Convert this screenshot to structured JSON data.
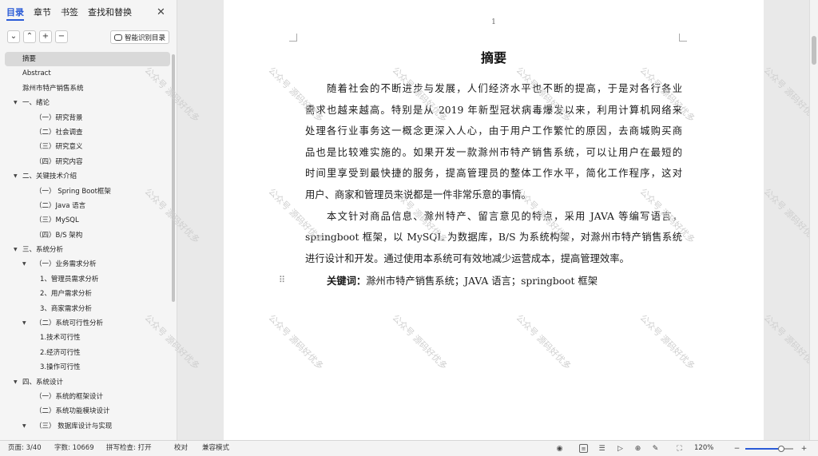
{
  "nav": {
    "tabs": [
      "目录",
      "章节",
      "书签",
      "查找和替换"
    ],
    "smart_toc_label": "智能识别目录",
    "toc": [
      {
        "label": "摘要",
        "level": 0,
        "selected": true
      },
      {
        "label": "Abstract",
        "level": 0
      },
      {
        "label": "滁州市特产销售系统",
        "level": 0
      },
      {
        "label": "一、绪论",
        "level": 0,
        "caret": true
      },
      {
        "label": "（一）研究背景",
        "level": 1
      },
      {
        "label": "（二）社会调查",
        "level": 1
      },
      {
        "label": "（三）研究意义",
        "level": 1
      },
      {
        "label": "（四）研究内容",
        "level": 1
      },
      {
        "label": "二、关键技术介绍",
        "level": 0,
        "caret": true
      },
      {
        "label": "（一）    Spring Boot框架",
        "level": 1
      },
      {
        "label": "（二）Java 语言",
        "level": 1
      },
      {
        "label": "（三）MySQL",
        "level": 1
      },
      {
        "label": "（四）B/S 架构",
        "level": 1
      },
      {
        "label": "三、系统分析",
        "level": 0,
        "caret": true
      },
      {
        "label": "（一）业务需求分析",
        "level": 1,
        "caret": true
      },
      {
        "label": "1、管理员需求分析",
        "level": 2
      },
      {
        "label": "2、用户需求分析",
        "level": 2
      },
      {
        "label": "3、商家需求分析",
        "level": 2
      },
      {
        "label": "（二）系统可行性分析",
        "level": 1,
        "caret": true
      },
      {
        "label": "1.技术可行性",
        "level": 2
      },
      {
        "label": "2.经济可行性",
        "level": 2
      },
      {
        "label": "3.操作可行性",
        "level": 2
      },
      {
        "label": "四、系统设计",
        "level": 0,
        "caret": true
      },
      {
        "label": "（一）系统的框架设计",
        "level": 1
      },
      {
        "label": "（二）系统功能模块设计",
        "level": 1
      },
      {
        "label": "（三）    数据库设计与实现",
        "level": 1,
        "caret": true
      }
    ]
  },
  "document": {
    "page_number": "1",
    "title": "摘要",
    "lines": [
      "　　随着社会的不断进步与发展，人们经济水平也不断的提高，于是对各行各业",
      "需求也越来越高。特别是从 2019 年新型冠状病毒爆发以来，利用计算机网络来",
      "处理各行业事务这一概念更深入人心，由于用户工作繁忙的原因，去商城购买商",
      "品也是比较难实施的。如果开发一款滁州市特产销售系统，可以让用户在最短的",
      "时间里享受到最快捷的服务，提高管理员的整体工作水平，简化工作程序，这对",
      "用户、商家和管理员来说都是一件非常乐意的事情。",
      "　　本文针对商品信息、滁州特产、留言意见的特点，采用 JAVA 等编写语言，",
      "springboot 框架，以 MySQL 为数据库，B/S 为系统构架，对滁州市特产销售系统",
      "进行设计和开发。通过使用本系统可有效地减少运营成本，提高管理效率。"
    ],
    "keywords_label": "关键词：",
    "keywords_text": "滁州市特产销售系统；JAVA 语言；springboot 框架",
    "watermark": "公众号 源码好优多"
  },
  "status": {
    "page": "页面: 3/40",
    "words": "字数: 10669",
    "spell": "拼写检查: 打开",
    "proof": "校对",
    "compat": "兼容模式",
    "zoom": "120%",
    "zoom_level": 0.75
  },
  "icons": {
    "close": "close-icon",
    "collapse": "chevron-down-icon",
    "expand": "chevron-up-icon",
    "add": "plus-icon",
    "remove": "minus-icon",
    "smart": "ai-icon",
    "drag": "drag-handle-icon",
    "eye": "eye-icon",
    "page_view": "page-view-icon",
    "outline_view": "outline-view-icon",
    "play": "play-icon",
    "web": "globe-icon",
    "write": "pen-icon",
    "fit": "fit-page-icon",
    "zoom_out": "zoom-out-icon",
    "zoom_in": "zoom-in-icon"
  }
}
